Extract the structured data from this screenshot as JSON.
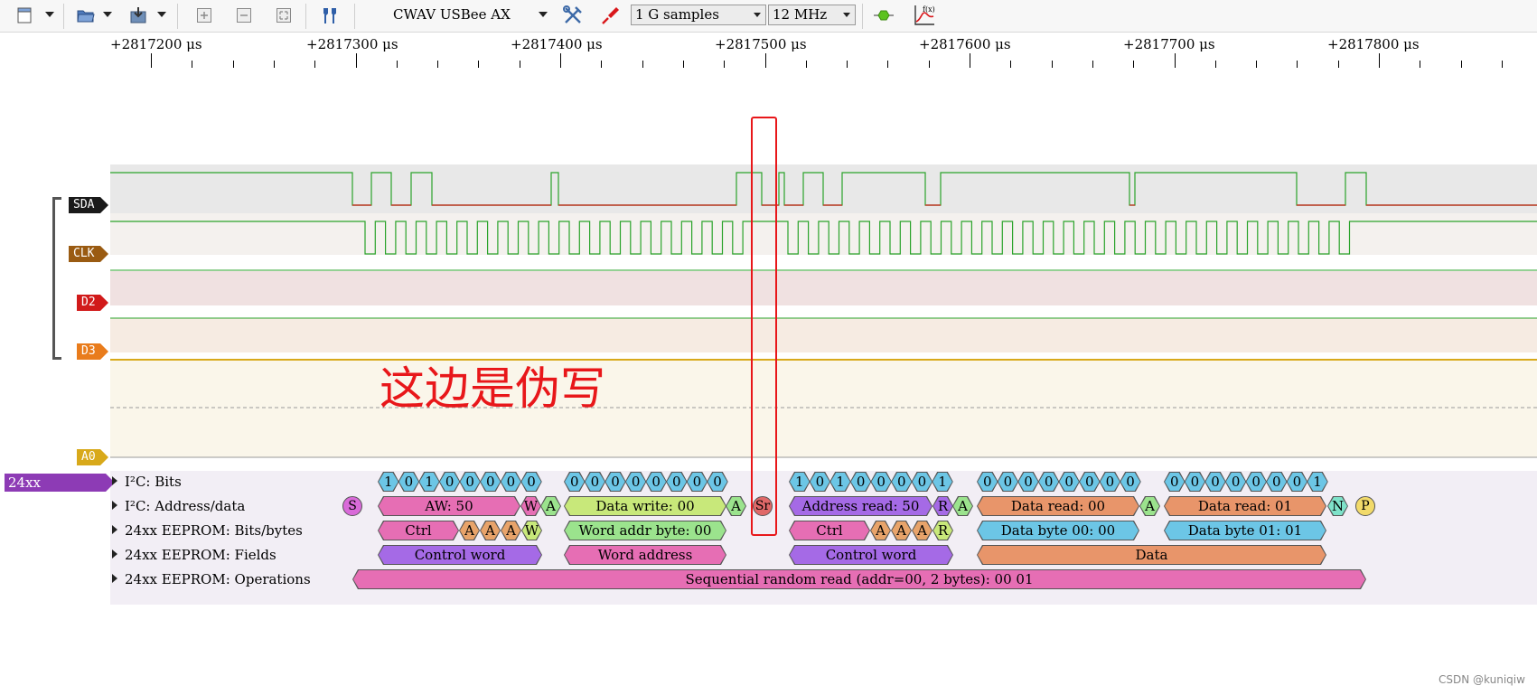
{
  "toolbar": {
    "device": "CWAV USBee AX",
    "samples": "1 G samples",
    "rate": "12 MHz",
    "colors": {
      "analyzer_icon": "#5cc21e",
      "probe_icon": "#d9171b"
    }
  },
  "ruler": {
    "unit": "μs",
    "labels": [
      "+2817200  μs",
      "+2817300  μs",
      "+2817400  μs",
      "+2817500  μs",
      "+2817600  μs",
      "+2817700  μs",
      "+2817800  μs"
    ]
  },
  "channels": [
    {
      "name": "SDA",
      "color": "#1a1a1a"
    },
    {
      "name": "CLK",
      "color": "#9a5b12"
    },
    {
      "name": "D2",
      "color": "#d11a1a"
    },
    {
      "name": "D3",
      "color": "#e97c1c"
    },
    {
      "name": "A0",
      "color": "#d8a91a"
    }
  ],
  "decoder": {
    "tag": "24xx EEPROM",
    "rows": [
      "I²C: Bits",
      "I²C: Address/data",
      "24xx EEPROM: Bits/bytes",
      "24xx EEPROM: Fields",
      "24xx EEPROM: Operations"
    ],
    "bits": [
      [
        "1",
        "0",
        "1",
        "0",
        "0",
        "0",
        "0",
        "0"
      ],
      [
        "0",
        "0",
        "0",
        "0",
        "0",
        "0",
        "0",
        "0"
      ],
      [
        "1",
        "0",
        "1",
        "0",
        "0",
        "0",
        "0",
        "1"
      ],
      [
        "0",
        "0",
        "0",
        "0",
        "0",
        "0",
        "0",
        "0"
      ],
      [
        "0",
        "0",
        "0",
        "0",
        "0",
        "0",
        "0",
        "1"
      ]
    ],
    "address_data": {
      "start": "S",
      "aw": "AW: 50",
      "w": "W",
      "ack": "A",
      "data_write": "Data write: 00",
      "repeat_start": "Sr",
      "address_read": "Address read: 50",
      "r": "R",
      "data_read_1": "Data read: 00",
      "data_read_2": "Data read: 01",
      "nack": "N",
      "stop": "P"
    },
    "bits_bytes": {
      "ctrl": "Ctrl",
      "a": "A",
      "w": "W",
      "r": "R",
      "word_addr": "Word addr byte: 00",
      "data_byte_1": "Data byte 00: 00",
      "data_byte_2": "Data byte 01: 01"
    },
    "fields": {
      "control_word": "Control word",
      "word_address": "Word address",
      "data": "Data"
    },
    "operation": "Sequential random read (addr=00, 2 bytes): 00 01"
  },
  "annotation": "这边是伪写",
  "watermark": "CSDN @kuniqiw"
}
